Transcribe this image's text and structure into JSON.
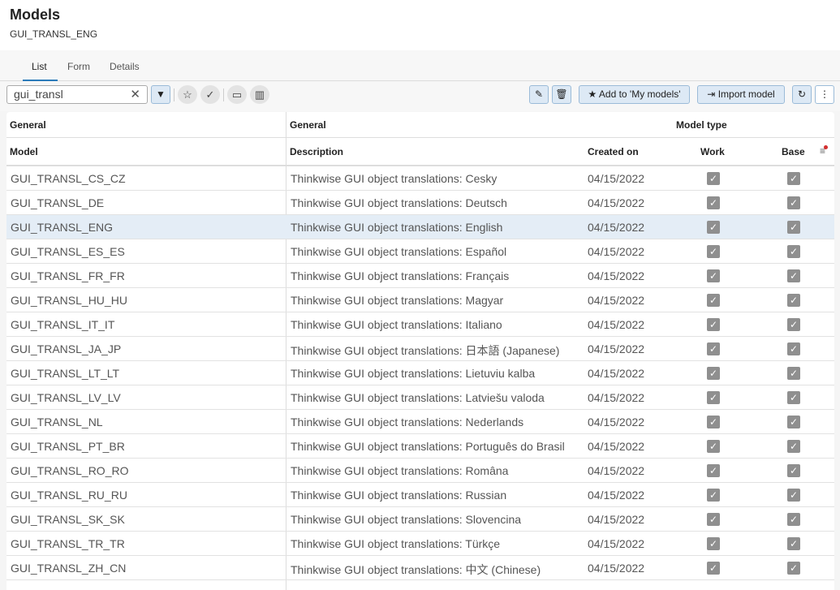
{
  "header": {
    "title": "Models",
    "subtitle": "GUI_TRANSL_ENG"
  },
  "tabs": [
    {
      "label": "List"
    },
    {
      "label": "Form"
    },
    {
      "label": "Details"
    }
  ],
  "toolbar": {
    "search_value": "gui_transl",
    "add_label": "Add to 'My models'",
    "import_label": "Import model"
  },
  "grid": {
    "groups": [
      "General",
      "General",
      "Model type"
    ],
    "columns": [
      "Model",
      "Description",
      "Created on",
      "Work",
      "Base"
    ],
    "selected_index": 2,
    "rows": [
      [
        "GUI_TRANSL_CS_CZ",
        "Thinkwise GUI object translations: Cesky",
        "04/15/2022",
        true,
        true
      ],
      [
        "GUI_TRANSL_DE",
        "Thinkwise GUI object translations: Deutsch",
        "04/15/2022",
        true,
        true
      ],
      [
        "GUI_TRANSL_ENG",
        "Thinkwise GUI object translations: English",
        "04/15/2022",
        true,
        true
      ],
      [
        "GUI_TRANSL_ES_ES",
        "Thinkwise GUI object translations: Español",
        "04/15/2022",
        true,
        true
      ],
      [
        "GUI_TRANSL_FR_FR",
        "Thinkwise GUI object translations: Français",
        "04/15/2022",
        true,
        true
      ],
      [
        "GUI_TRANSL_HU_HU",
        "Thinkwise GUI object translations: Magyar",
        "04/15/2022",
        true,
        true
      ],
      [
        "GUI_TRANSL_IT_IT",
        "Thinkwise GUI object translations: Italiano",
        "04/15/2022",
        true,
        true
      ],
      [
        "GUI_TRANSL_JA_JP",
        "Thinkwise GUI object translations: 日本語 (Japanese)",
        "04/15/2022",
        true,
        true
      ],
      [
        "GUI_TRANSL_LT_LT",
        "Thinkwise GUI object translations: Lietuviu kalba",
        "04/15/2022",
        true,
        true
      ],
      [
        "GUI_TRANSL_LV_LV",
        "Thinkwise GUI object translations: Latviešu valoda",
        "04/15/2022",
        true,
        true
      ],
      [
        "GUI_TRANSL_NL",
        "Thinkwise GUI object translations: Nederlands",
        "04/15/2022",
        true,
        true
      ],
      [
        "GUI_TRANSL_PT_BR",
        "Thinkwise GUI object translations: Português do Brasil",
        "04/15/2022",
        true,
        true
      ],
      [
        "GUI_TRANSL_RO_RO",
        "Thinkwise GUI object translations: Româna",
        "04/15/2022",
        true,
        true
      ],
      [
        "GUI_TRANSL_RU_RU",
        "Thinkwise GUI object translations: Russian",
        "04/15/2022",
        true,
        true
      ],
      [
        "GUI_TRANSL_SK_SK",
        "Thinkwise GUI object translations: Slovencina",
        "04/15/2022",
        true,
        true
      ],
      [
        "GUI_TRANSL_TR_TR",
        "Thinkwise GUI object translations: Türkçe",
        "04/15/2022",
        true,
        true
      ],
      [
        "GUI_TRANSL_ZH_CN",
        "Thinkwise GUI object translations: 中文 (Chinese)",
        "04/15/2022",
        true,
        true
      ]
    ]
  }
}
